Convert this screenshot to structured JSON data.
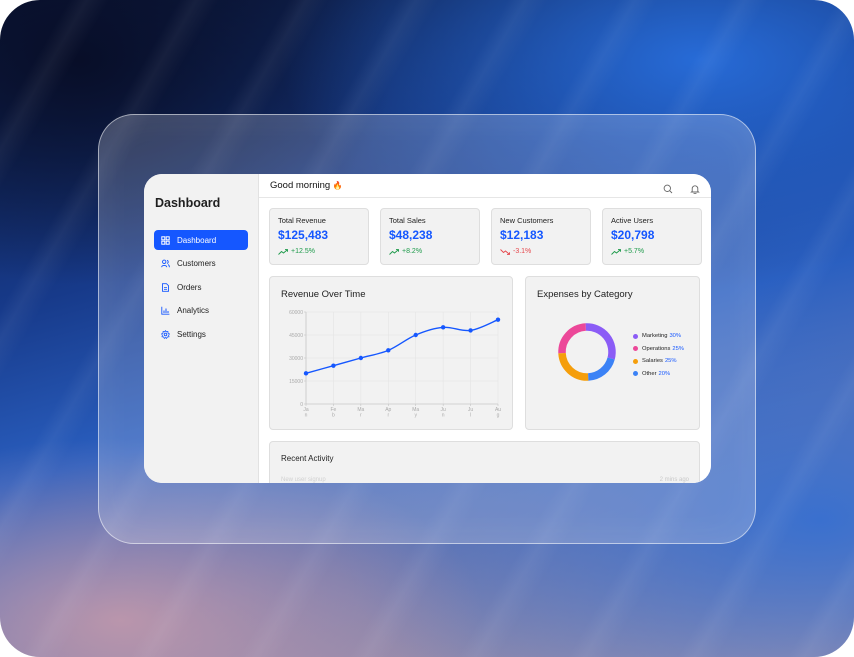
{
  "sidebar": {
    "title": "Dashboard",
    "items": [
      {
        "label": "Dashboard",
        "icon": "grid-icon",
        "active": true
      },
      {
        "label": "Customers",
        "icon": "users-icon",
        "active": false
      },
      {
        "label": "Orders",
        "icon": "document-icon",
        "active": false
      },
      {
        "label": "Analytics",
        "icon": "bar-chart-icon",
        "active": false
      },
      {
        "label": "Settings",
        "icon": "gear-icon",
        "active": false
      }
    ]
  },
  "topbar": {
    "greeting": "Good morning",
    "greeting_emoji": "🔥",
    "icons": [
      "search-icon",
      "bell-icon"
    ]
  },
  "cards": [
    {
      "title": "Total Revenue",
      "value": "$125,483",
      "delta": "+12.5%",
      "trend": "up"
    },
    {
      "title": "Total Sales",
      "value": "$48,238",
      "delta": "+8.2%",
      "trend": "up"
    },
    {
      "title": "New Customers",
      "value": "$12,183",
      "delta": "-3.1%",
      "trend": "down"
    },
    {
      "title": "Active Users",
      "value": "$20,798",
      "delta": "+5.7%",
      "trend": "up"
    }
  ],
  "revenue_panel": {
    "title": "Revenue Over Time"
  },
  "expenses_panel": {
    "title": "Expenses by Category"
  },
  "recent_panel": {
    "title": "Recent Activity",
    "faint_left": "New user signup",
    "faint_right": "2 mins ago"
  },
  "colors": {
    "accent": "#1557ff",
    "up": "#1d9a4a",
    "down": "#e5484d",
    "marketing": "#8b5cf6",
    "operations": "#ec4899",
    "salaries": "#f59e0b",
    "other": "#3b82f6"
  },
  "chart_data": [
    {
      "type": "line",
      "title": "Revenue Over Time",
      "x": [
        "Jan",
        "Feb",
        "Mar",
        "Apr",
        "May",
        "Jun",
        "Jul",
        "Aug"
      ],
      "x_tick_lines": [
        [
          "Ja",
          "n"
        ],
        [
          "Fe",
          "b"
        ],
        [
          "Ma",
          "r"
        ],
        [
          "Ap",
          "r"
        ],
        [
          "Ma",
          "y"
        ],
        [
          "Ju",
          "n"
        ],
        [
          "Ju",
          "l"
        ],
        [
          "Au",
          "g"
        ]
      ],
      "y_ticks": [
        "0",
        "15000",
        "30000",
        "45000",
        "60000"
      ],
      "ylim": [
        0,
        60000
      ],
      "series": [
        {
          "values": [
            20000,
            25000,
            30000,
            35000,
            45000,
            50000,
            48000,
            55000
          ]
        }
      ],
      "grid": true
    },
    {
      "type": "pie",
      "title": "Expenses by Category",
      "donut": true,
      "categories": [
        "Marketing",
        "Operations",
        "Salaries",
        "Other"
      ],
      "values": [
        30,
        25,
        25,
        20
      ],
      "labels": [
        "30%",
        "25%",
        "25%",
        "20%"
      ]
    }
  ]
}
